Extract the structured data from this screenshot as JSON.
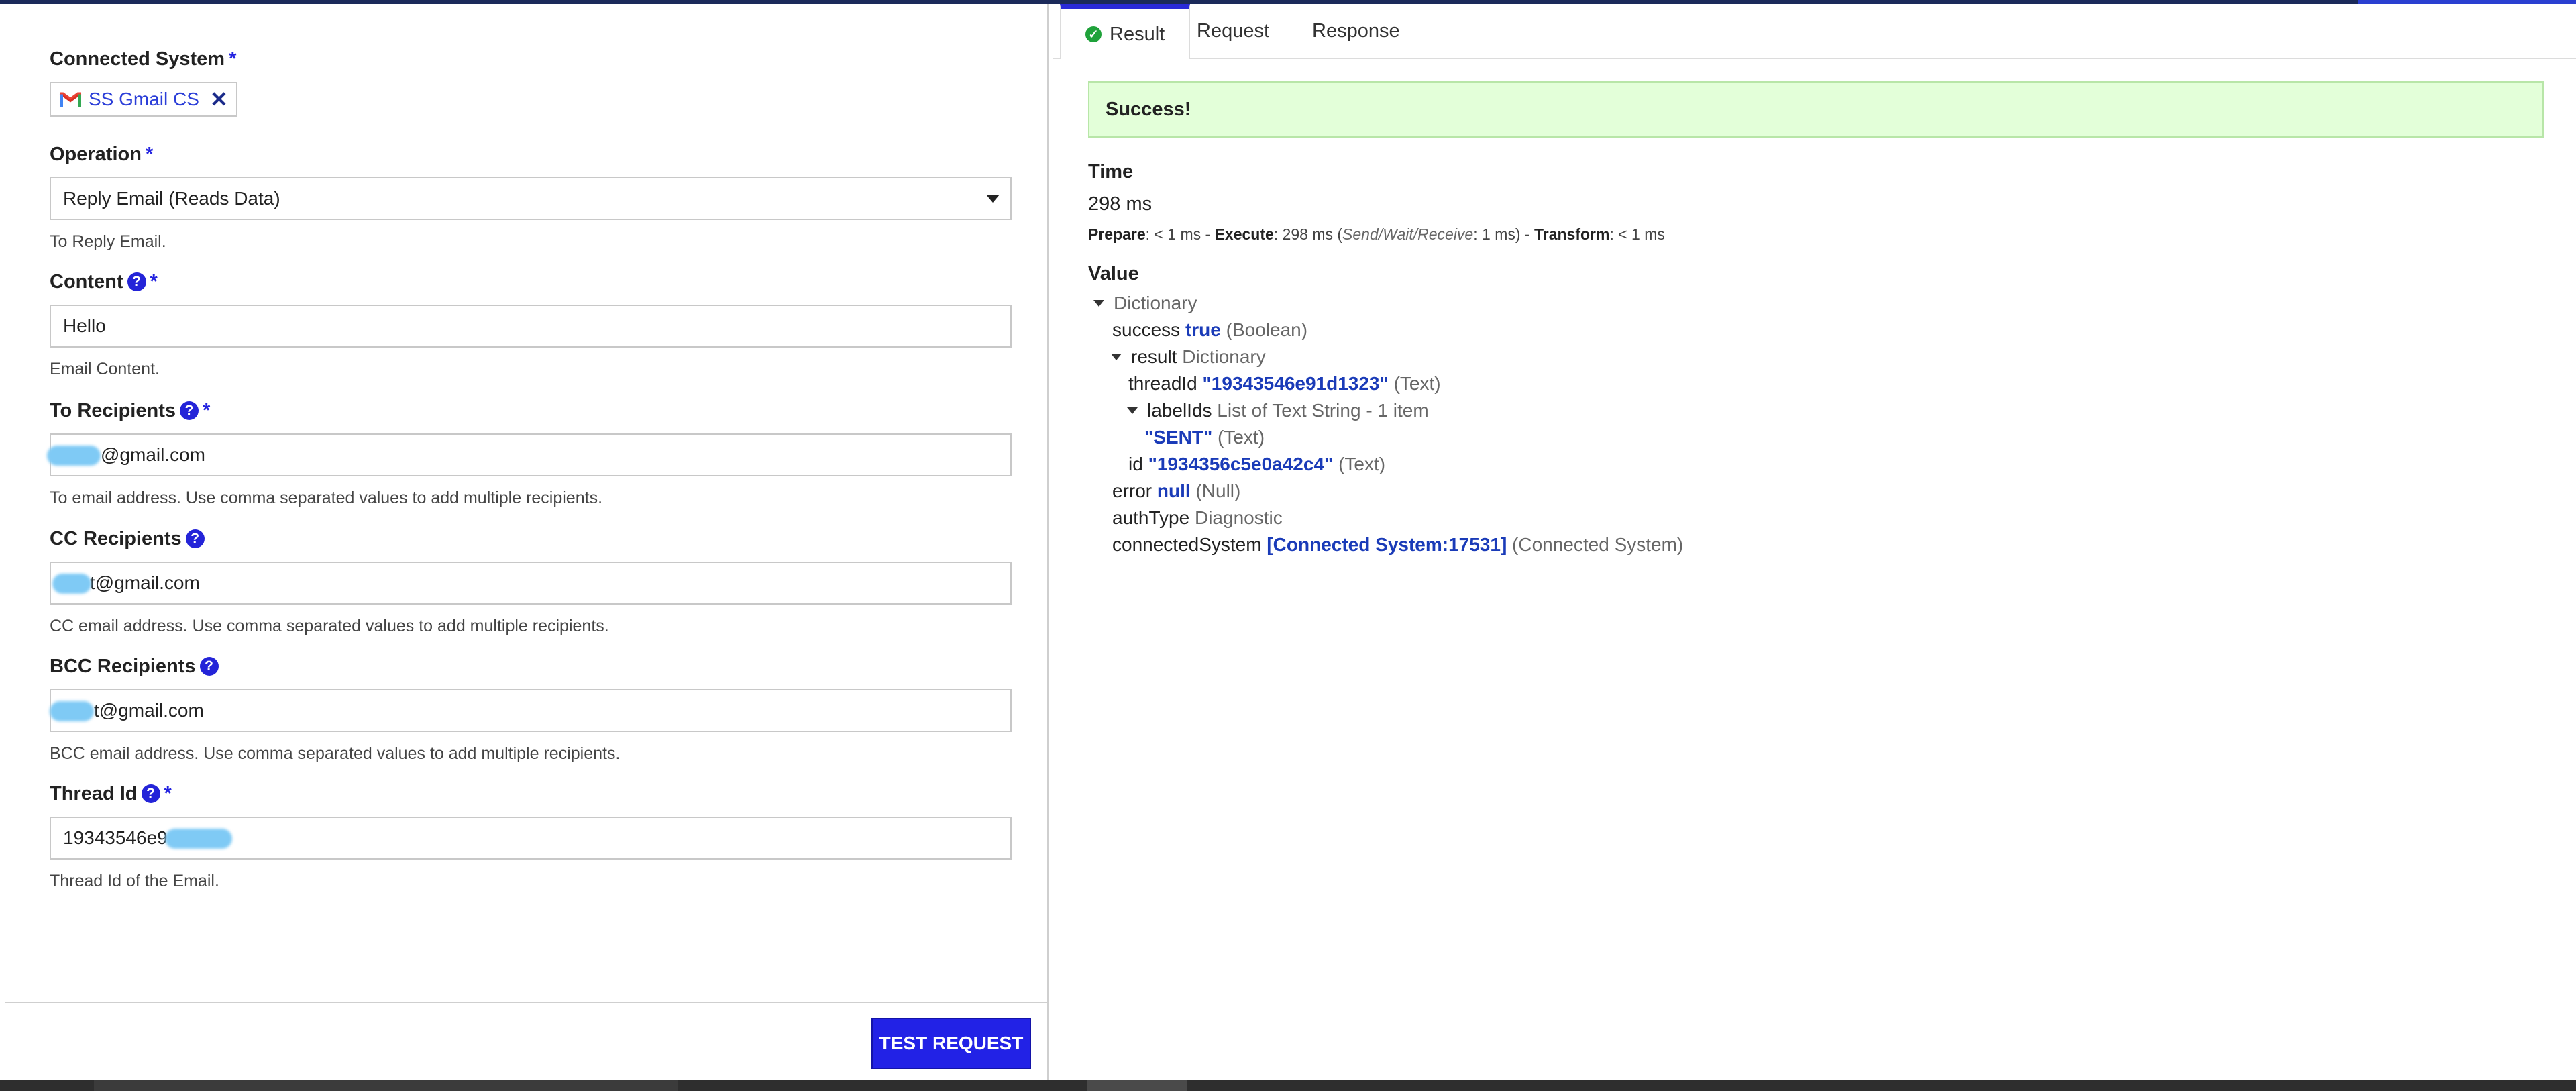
{
  "left_panel": {
    "connected_system": {
      "label": "Connected System",
      "required": "*",
      "chip_label": "SS Gmail CS",
      "remove_icon": "close-icon"
    },
    "operation": {
      "label": "Operation",
      "required": "*",
      "value": "Reply Email (Reads Data)",
      "hint": "To Reply Email."
    },
    "content": {
      "label": "Content",
      "required": "*",
      "help": "?",
      "value": "Hello",
      "hint": "Email Content."
    },
    "to_recipients": {
      "label": "To Recipients",
      "required": "*",
      "help": "?",
      "value": "@gmail.com",
      "hint": "To email address. Use comma separated values to add multiple recipients."
    },
    "cc_recipients": {
      "label": "CC Recipients",
      "help": "?",
      "value": "t@gmail.com",
      "hint": "CC email address. Use comma separated values to add multiple recipients."
    },
    "bcc_recipients": {
      "label": "BCC Recipients",
      "help": "?",
      "value": "t@gmail.com",
      "hint": "BCC email address. Use comma separated values to add multiple recipients."
    },
    "thread_id": {
      "label": "Thread Id",
      "required": "*",
      "help": "?",
      "value": "19343546e9",
      "hint": "Thread Id of the Email."
    },
    "test_button_label": "TEST REQUEST"
  },
  "right_panel": {
    "tabs": [
      {
        "label": "Result",
        "active": true
      },
      {
        "label": "Request",
        "active": false
      },
      {
        "label": "Response",
        "active": false
      }
    ],
    "banner": "Success!",
    "time": {
      "title": "Time",
      "value": "298 ms",
      "prepare_label": "Prepare",
      "prepare_value": ": < 1 ms - ",
      "execute_label": "Execute",
      "execute_value": ": 298 ms (",
      "swr_label": "Send/Wait/Receive",
      "swr_value": ": 1 ms) - ",
      "transform_label": "Transform",
      "transform_value": ": < 1 ms"
    },
    "value_title": "Value",
    "tree": {
      "root_type": "Dictionary",
      "success_key": "success",
      "success_val": "true",
      "success_type": "(Boolean)",
      "result_key": "result",
      "result_type": "Dictionary",
      "threadid_key": "threadId",
      "threadid_val": "\"19343546e91d1323\"",
      "threadid_type": "(Text)",
      "labelids_key": "labelIds",
      "labelids_type": "List of Text String - 1 item",
      "sent_val": "\"SENT\"",
      "sent_type": "(Text)",
      "id_key": "id",
      "id_val": "\"1934356c5e0a42c4\"",
      "id_type": "(Text)",
      "error_key": "error",
      "error_val": "null",
      "error_type": "(Null)",
      "authtype_key": "authType",
      "authtype_val": "Diagnostic",
      "connsys_key": "connectedSystem",
      "connsys_val": "[Connected System:17531]",
      "connsys_type": "(Connected System)"
    }
  },
  "colors": {
    "accent": "#2222e6",
    "success_bg": "#e3ffd9",
    "value_blue": "#1a3bb8",
    "blur": "#7fcaf5"
  }
}
